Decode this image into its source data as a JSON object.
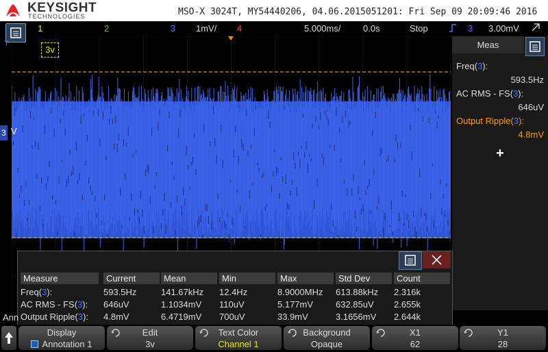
{
  "header": {
    "brand": "KEYSIGHT",
    "brand_sub": "TECHNOLOGIES",
    "title": "MSO-X 3024T, MY54440206, 04.06.2015051201: Fri Sep 09 20:09:46 2016"
  },
  "status": {
    "ch1": "1",
    "ch2": "2",
    "ch3": "3",
    "ch3_scale": "1mV/",
    "ch4": "4",
    "timebase": "5.000ms/",
    "delay": "0.0s",
    "run_state": "Stop",
    "trigger_channel": "3",
    "trigger_level": "3.00mV"
  },
  "colors": {
    "ch1": "#e8e800",
    "ch2": "#3ccc3c",
    "ch3": "#4a73ff",
    "ch4": "#ff4050",
    "cursor": "#e8893a",
    "ripple": "#ff9a00"
  },
  "graticule": {
    "annotation": "3v",
    "ch3_marker": "3",
    "ch3_marker_suffix": "V",
    "trigger_marker": "T"
  },
  "meas_panel": {
    "tab": "Meas",
    "items": [
      {
        "label": "Freq(",
        "ch": "3",
        "close": "):",
        "value": "593.5Hz"
      },
      {
        "label": "AC RMS - FS(",
        "ch": "3",
        "close": "):",
        "value": "646uV"
      },
      {
        "label": "Output Ripple(",
        "ch": "3",
        "close": "):",
        "value": "4.8mV"
      }
    ],
    "add": "+"
  },
  "table": {
    "headers": [
      "Measure",
      "Current",
      "Mean",
      "Min",
      "Max",
      "Std Dev",
      "Count"
    ],
    "rows": [
      {
        "name": "Freq(",
        "ch": "3",
        "close": "):",
        "cells": [
          "593.5Hz",
          "141.67kHz",
          "12.4Hz",
          "8.9000MHz",
          "613.88kHz",
          "2.316k"
        ]
      },
      {
        "name": "AC RMS - FS(",
        "ch": "3",
        "close": "):",
        "cells": [
          "646uV",
          "1.1034mV",
          "110uV",
          "5.177mV",
          "632.85uV",
          "2.655k"
        ]
      },
      {
        "name": "Output Ripple(",
        "ch": "3",
        "close": "):",
        "cells": [
          "4.8mV",
          "6.4719mV",
          "700uV",
          "33.9mV",
          "3.1656mV",
          "2.644k"
        ]
      }
    ]
  },
  "left_cut_label": "Ann",
  "softkeys": [
    {
      "title": "Display",
      "value": "Annotation 1"
    },
    {
      "title": "Edit",
      "value": "3v"
    },
    {
      "title": "Text Color",
      "value": "Channel 1"
    },
    {
      "title": "Background",
      "value": "Opaque"
    },
    {
      "title": "X1",
      "value": "62"
    },
    {
      "title": "Y1",
      "value": "28"
    }
  ]
}
